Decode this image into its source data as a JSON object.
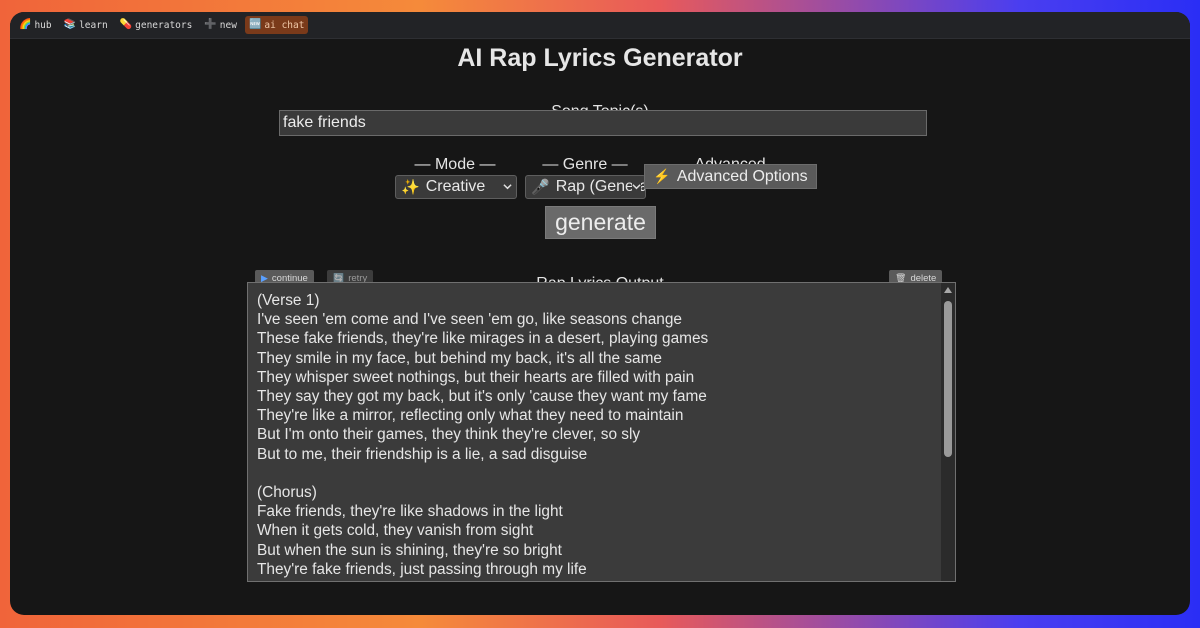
{
  "nav": {
    "items": [
      {
        "icon": "🌈",
        "label": "hub"
      },
      {
        "icon": "📚",
        "label": "learn"
      },
      {
        "icon": "💊",
        "label": "generators"
      },
      {
        "icon": "➕",
        "label": "new"
      },
      {
        "icon": "🆕",
        "label": "ai chat"
      }
    ]
  },
  "page": {
    "title": "AI Rap Lyrics Generator"
  },
  "topic": {
    "label": "— Song Topic(s) —",
    "value": "fake friends"
  },
  "mode": {
    "label": "— Mode —",
    "icon": "✨",
    "value": "Creative"
  },
  "genre": {
    "label": "— Genre —",
    "icon": "🎤",
    "value": "Rap (General)"
  },
  "advanced": {
    "label": "— Advanced —",
    "icon": "⚡",
    "button": "Advanced Options"
  },
  "generate": {
    "label": "generate"
  },
  "output": {
    "label": "— Rap Lyrics Output —",
    "continue_icon": "▶",
    "continue_label": "continue",
    "retry_icon": "🔄",
    "retry_label": "retry",
    "delete_icon": "🗑",
    "delete_label": "delete",
    "text": "(Verse 1)\nI've seen 'em come and I've seen 'em go, like seasons change\nThese fake friends, they're like mirages in a desert, playing games\nThey smile in my face, but behind my back, it's all the same\nThey whisper sweet nothings, but their hearts are filled with pain\nThey say they got my back, but it's only 'cause they want my fame\nThey're like a mirror, reflecting only what they need to maintain\nBut I'm onto their games, they think they're clever, so sly\nBut to me, their friendship is a lie, a sad disguise\n\n(Chorus)\nFake friends, they're like shadows in the light\nWhen it gets cold, they vanish from sight\nBut when the sun is shining, they're so bright\nThey're fake friends, just passing through my life"
  }
}
